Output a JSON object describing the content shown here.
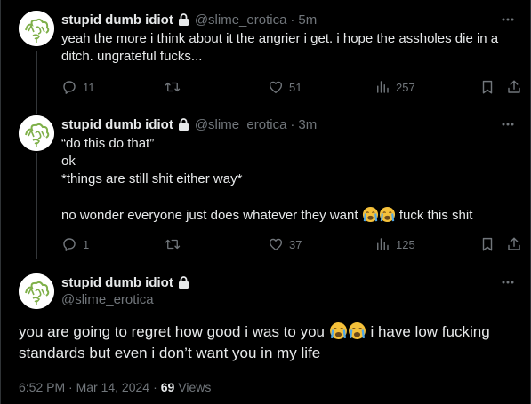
{
  "colors": {
    "background": "#000000",
    "primary_text": "#e7e9ea",
    "secondary_text": "#71767b",
    "thread_line": "#333639",
    "avatar_ink": "#7fb04a",
    "emoji": "#f5c13a"
  },
  "icons": [
    "lock-icon",
    "more-icon",
    "reply-icon",
    "retweet-icon",
    "like-icon",
    "views-icon",
    "bookmark-icon",
    "share-icon",
    "loudly-crying-face-emoji",
    "avatar-doodle"
  ],
  "tweets": [
    {
      "display_name": "stupid dumb idiot",
      "handle": "@slime_erotica",
      "separator": "·",
      "time": "5m",
      "text_segments": [
        "yeah the more i think about it the angrier i get. i hope the assholes die in a ditch. ungrateful fucks..."
      ],
      "stats": {
        "replies": "11",
        "retweets": "",
        "likes": "51",
        "views": "257"
      }
    },
    {
      "display_name": "stupid dumb idiot",
      "handle": "@slime_erotica",
      "separator": "·",
      "time": "3m",
      "lines": [
        "“do this do that”",
        "ok",
        "*things are still shit either way*",
        ""
      ],
      "last_line_before_emoji": "no wonder everyone just does whatever they want",
      "last_line_after_emoji": "fuck this shit",
      "stats": {
        "replies": "1",
        "retweets": "",
        "likes": "37",
        "views": "125"
      }
    }
  ],
  "main_tweet": {
    "display_name": "stupid dumb idiot",
    "handle": "@slime_erotica",
    "text_before_emoji": "you are going to regret how good i was to you",
    "text_after_emoji": "i have low fucking standards but even i don’t want you in my life",
    "timestamp": "6:52 PM · Mar 14, 2024",
    "meta_separator": "·",
    "views_count": "69",
    "views_label": "Views"
  }
}
